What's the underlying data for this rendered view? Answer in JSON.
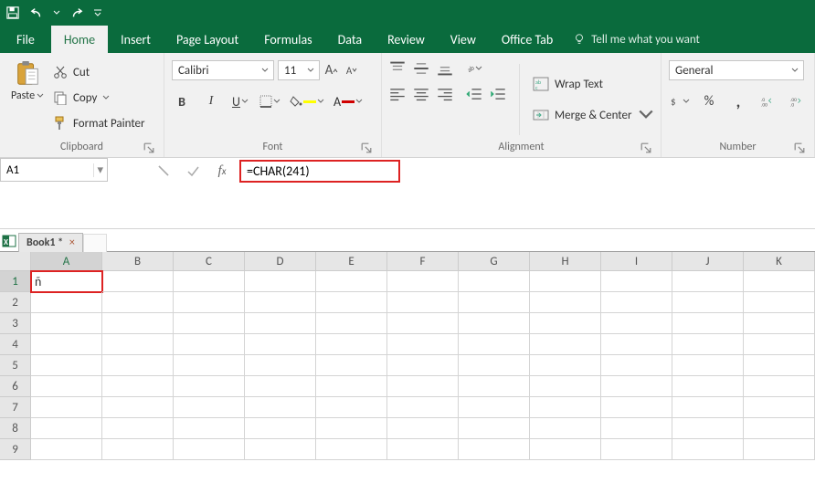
{
  "titlebar": {
    "save_icon": "save",
    "undo_icon": "undo",
    "redo_icon": "redo"
  },
  "tabs": {
    "file": "File",
    "home": "Home",
    "insert": "Insert",
    "page_layout": "Page Layout",
    "formulas": "Formulas",
    "data": "Data",
    "review": "Review",
    "view": "View",
    "office_tab": "Office Tab",
    "tell_me": "Tell me what you want"
  },
  "ribbon": {
    "clipboard": {
      "paste": "Paste",
      "cut": "Cut",
      "copy": "Copy",
      "format_painter": "Format Painter",
      "label": "Clipboard"
    },
    "font": {
      "name": "Calibri",
      "size": "11",
      "label": "Font"
    },
    "alignment": {
      "wrap": "Wrap Text",
      "merge": "Merge & Center",
      "label": "Alignment"
    },
    "number": {
      "format": "General",
      "label": "Number"
    }
  },
  "formula_bar": {
    "name_box": "A1",
    "formula": "=CHAR(241)"
  },
  "workbook": {
    "tab_name": "Book1 *"
  },
  "grid": {
    "columns": [
      "A",
      "B",
      "C",
      "D",
      "E",
      "F",
      "G",
      "H",
      "I",
      "J",
      "K"
    ],
    "rows": [
      "1",
      "2",
      "3",
      "4",
      "5",
      "6",
      "7",
      "8",
      "9"
    ],
    "selected_cell": "A1",
    "cell_A1": "ñ"
  }
}
